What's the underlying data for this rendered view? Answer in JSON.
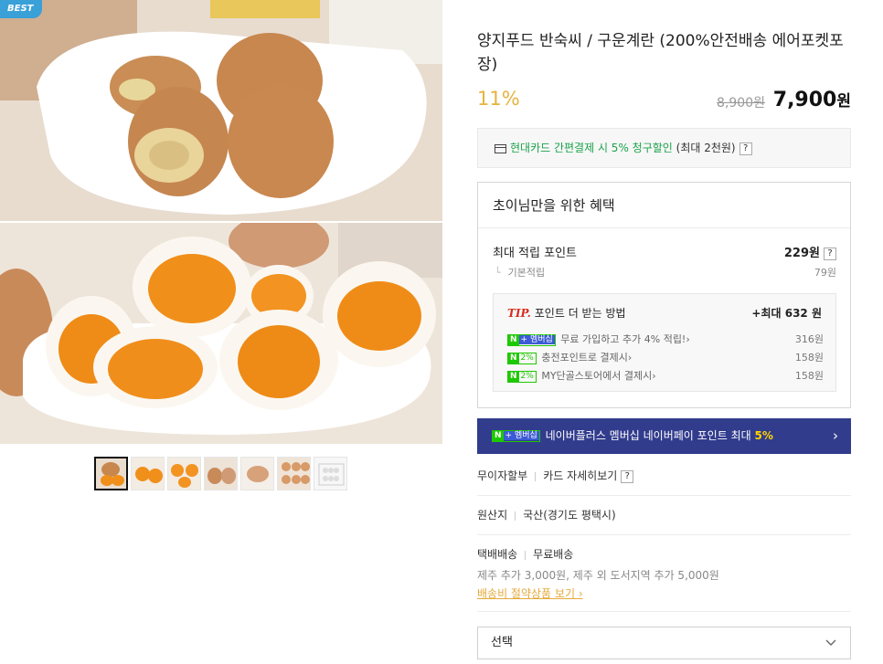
{
  "badge": "BEST",
  "product": {
    "title": "양지푸드 반숙씨 / 구운계란 (200%안전배송 에어포켓포장)",
    "discount": "11%",
    "original_price": "8,900원",
    "sale_price": "7,900",
    "sale_unit": "원"
  },
  "card_promo": {
    "text_green": "현대카드 간편결제 시 5% 청구할인",
    "text_rest": " (최대 2천원)",
    "help": "?"
  },
  "benefit": {
    "title": "초이님만을 위한 혜택",
    "max_label": "최대 적립 포인트",
    "max_value": "229원",
    "help": "?",
    "base_label": "기본적립",
    "base_value": "79원",
    "tip_label": "TIP.",
    "tip_title": "포인트 더 받는 방법",
    "tip_max": "+최대 632 원",
    "items": [
      {
        "badge_n": "N",
        "badge_text": "+ 멤버십",
        "label": "무료 가입하고 추가 4% 적립!",
        "value": "316원"
      },
      {
        "badge_n": "N",
        "badge_text": "2%",
        "label": "충전포인트로 결제시",
        "value": "158원"
      },
      {
        "badge_n": "N",
        "badge_text": "2%",
        "label": "MY단골스토어에서 결제시",
        "value": "158원"
      }
    ]
  },
  "naver_bar": {
    "badge_n": "N",
    "badge_text": "+ 멤버십",
    "text": "네이버플러스 멤버십 네이버페이 포인트 최대 ",
    "highlight": "5%"
  },
  "installment": {
    "label": "무이자할부",
    "link": "카드 자세히보기",
    "help": "?"
  },
  "origin": {
    "label": "원산지",
    "value": "국산(경기도 평택시)"
  },
  "shipping": {
    "label": "택배배송",
    "value": "무료배송",
    "extra": "제주 추가 3,000원, 제주 외 도서지역 추가 5,000원",
    "link": "배송비 절약상품 보기"
  },
  "select": {
    "label": "선택"
  },
  "icons": {
    "chevron_right": "›",
    "chevron_down": "⌄"
  },
  "colors": {
    "discount": "#e5b33e",
    "naver_bar": "#323c8d",
    "npay_green": "#1ec800",
    "card_green": "#1aa34a"
  }
}
